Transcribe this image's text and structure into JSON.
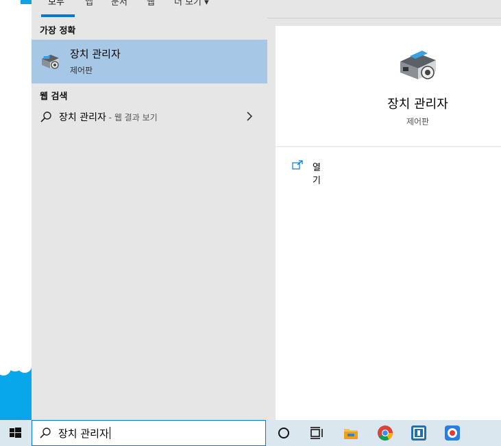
{
  "tabs": [
    {
      "label": "모두",
      "active": true
    },
    {
      "label": "앱",
      "active": false
    },
    {
      "label": "문서",
      "active": false
    },
    {
      "label": "웹",
      "active": false
    },
    {
      "label": "더 보기 ▾",
      "active": false
    }
  ],
  "best_match": {
    "section": "가장 정확",
    "title": "장치 관리자",
    "subtitle": "제어판",
    "icon": "device-manager-icon"
  },
  "web_search": {
    "section": "웹 검색",
    "query": "장치 관리자",
    "suffix": " - 웹 결과 보기"
  },
  "detail": {
    "title": "장치 관리자",
    "subtitle": "제어판",
    "actions": [
      {
        "label": "열기",
        "icon": "open-icon"
      }
    ]
  },
  "taskbar": {
    "search_value": "장치 관리자",
    "icons": [
      "cortana-icon",
      "task-view-icon",
      "file-explorer-icon",
      "chrome-icon",
      "app-icon",
      "recorder-icon"
    ]
  },
  "colors": {
    "accent": "#0078d7",
    "selection": "#a6c8e6",
    "panel": "#e6e6e6",
    "taskbar": "#dbe7ee"
  }
}
